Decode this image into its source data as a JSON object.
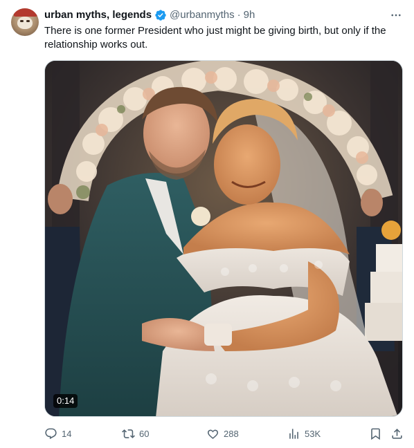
{
  "tweet": {
    "author_name": "urban myths, legends",
    "handle": "@urbanmyths",
    "separator": "·",
    "time": "9h",
    "text": "There is one former President who just might be giving birth, but only if the relationship works out.",
    "more_icon": "more-horizontal-icon"
  },
  "media": {
    "duration": "0:14"
  },
  "actions": {
    "replies": "14",
    "reposts": "60",
    "likes": "288",
    "views": "53K"
  },
  "colors": {
    "text_primary": "#0f1419",
    "text_secondary": "#536471",
    "verified_blue": "#1d9bf0",
    "border": "#cfd9de"
  }
}
